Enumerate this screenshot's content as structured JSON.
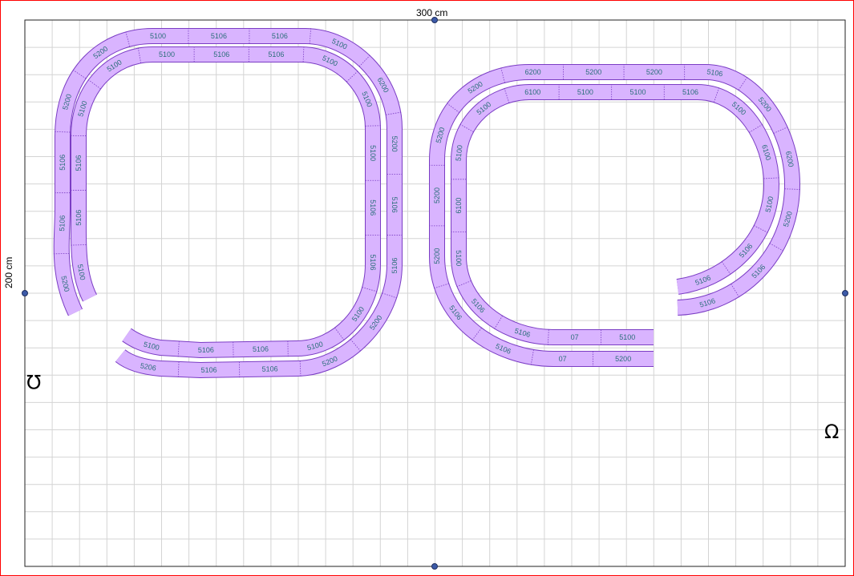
{
  "layout_board": {
    "width_label": "300 cm",
    "height_label": "200 cm",
    "grid_color": "#d4d4d4",
    "border_color": "#ff0000",
    "track_fill": "#d9b4ff",
    "track_stroke": "#7a3cc4",
    "label_color": "#2a6e7a"
  },
  "tracks": {
    "left_loop": {
      "outer_labels": [
        "5200",
        "5106",
        "5106",
        "5200",
        "5200",
        "5100",
        "5106",
        "5106",
        "5100",
        "6200",
        "5200",
        "5106",
        "5106",
        "5200",
        "5200",
        "5106",
        "5106",
        "5206"
      ],
      "inner_labels": [
        "5100",
        "5106",
        "5106",
        "5100",
        "5100",
        "5100",
        "5106",
        "5106",
        "5100",
        "5100",
        "5100",
        "5106",
        "5106",
        "5100",
        "5100",
        "5106",
        "5106",
        "5100"
      ]
    },
    "right_loop": {
      "outer_labels": [
        "5200",
        "07",
        "5106",
        "5106",
        "5200",
        "5200",
        "5200",
        "5200",
        "6200",
        "5200",
        "5200",
        "5106",
        "5200",
        "6200",
        "5200",
        "5106",
        "5106"
      ],
      "inner_labels": [
        "5100",
        "07",
        "5106",
        "5106",
        "5100",
        "6100",
        "5100",
        "5100",
        "6100",
        "5100",
        "5100",
        "5106",
        "5100",
        "6100",
        "5100",
        "5106",
        "5106"
      ]
    }
  },
  "icons": {
    "left_marker": "Ω",
    "right_marker": "Ω"
  }
}
